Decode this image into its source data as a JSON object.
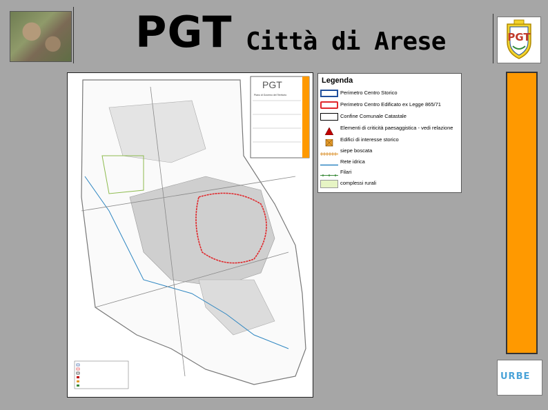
{
  "header": {
    "title_main": "PGT",
    "title_sub": "Città di Arese"
  },
  "map": {
    "title_block": {
      "heading": "PGT",
      "rows": [
        "Piano di Governo del Territorio"
      ]
    }
  },
  "legend": {
    "title": "Legenda",
    "items": [
      {
        "label": "Perimetro Centro Storico",
        "symbol": "blue-outline-rect",
        "color": "#1f4e9c"
      },
      {
        "label": "Perimetro Centro Edificato ex Legge 865/71",
        "symbol": "red-outline-rect",
        "color": "#e0262a"
      },
      {
        "label": "Confine Comunale Catastale",
        "symbol": "black-outline-rect",
        "color": "#000000"
      },
      {
        "label": "Elementi di criticità paesaggistica - vedi relazione",
        "symbol": "red-triangle",
        "color": "#c00000"
      },
      {
        "label": "Edifici di interesse storico",
        "symbol": "orange-square",
        "color": "#e39a2b"
      },
      {
        "label": "siepe boscata",
        "symbol": "hatched-line",
        "color": "#e8b070"
      },
      {
        "label": "Rete idrica",
        "symbol": "blue-line",
        "color": "#2e86c1"
      },
      {
        "label": "Filari",
        "symbol": "green-dotted-line",
        "color": "#3a8a3a"
      },
      {
        "label": "complessi rurali",
        "symbol": "light-green-rect",
        "color": "#e6f4c4"
      }
    ]
  },
  "logo": {
    "text": "URBE"
  },
  "colors": {
    "background": "#a6a6a6",
    "orange_panel": "#ff9900"
  }
}
